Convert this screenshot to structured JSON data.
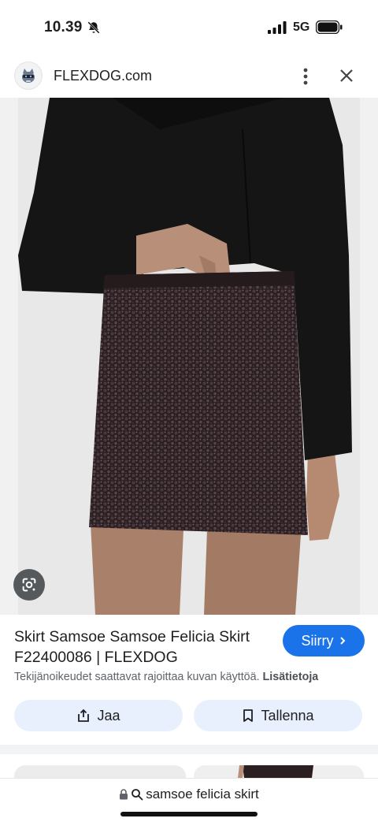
{
  "status_bar": {
    "time": "10.39",
    "network": "5G",
    "icons": [
      "bell-muted-icon",
      "signal-icon",
      "battery-icon"
    ]
  },
  "browser": {
    "site_name": "FLEXDOG.com",
    "icons": [
      "site-logo-icon",
      "more-vert-icon",
      "close-icon"
    ]
  },
  "image": {
    "alt": "Skirt Samsoe Samsoe Felicia",
    "lens_icon": "google-lens-icon"
  },
  "result": {
    "title": "Skirt Samsoe Samsoe Felicia Skirt F22400086 | FLEXDOG",
    "visit_label": "Siirry",
    "copyright_text": "Tekijänoikeudet saattavat rajoittaa kuvan käyttöä.",
    "more_info_label": "Lisätietoja",
    "share_label": "Jaa",
    "save_label": "Tallenna"
  },
  "bottom_bar": {
    "query": "samsoe felicia skirt"
  },
  "colors": {
    "accent": "#1a73e8",
    "button_bg": "#e8f0fe",
    "image_bg": "#f1f1f1"
  }
}
